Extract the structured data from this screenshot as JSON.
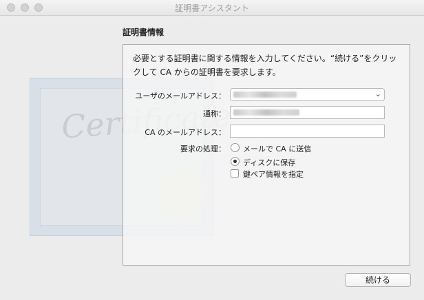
{
  "window": {
    "title": "証明書アシスタント"
  },
  "section": {
    "heading": "証明書情報",
    "description": "必要とする証明書に関する情報を入力してください。“続ける”をクリックして CA からの証明書を要求します。"
  },
  "form": {
    "user_email_label": "ユーザのメールアドレス：",
    "common_name_label": "通称：",
    "ca_email_label": "CA のメールアドレス：",
    "request_label": "要求の処理：",
    "user_email_value": "",
    "common_name_value": "",
    "ca_email_value": "",
    "options": {
      "email_ca": "メールで CA に送信",
      "save_to_disk": "ディスクに保存",
      "specify_key_pair": "鍵ペア情報を指定"
    },
    "selected_option": "save_to_disk",
    "specify_key_pair_checked": false
  },
  "buttons": {
    "continue": "続ける"
  },
  "decor": {
    "certificate_script": "Certificate"
  }
}
